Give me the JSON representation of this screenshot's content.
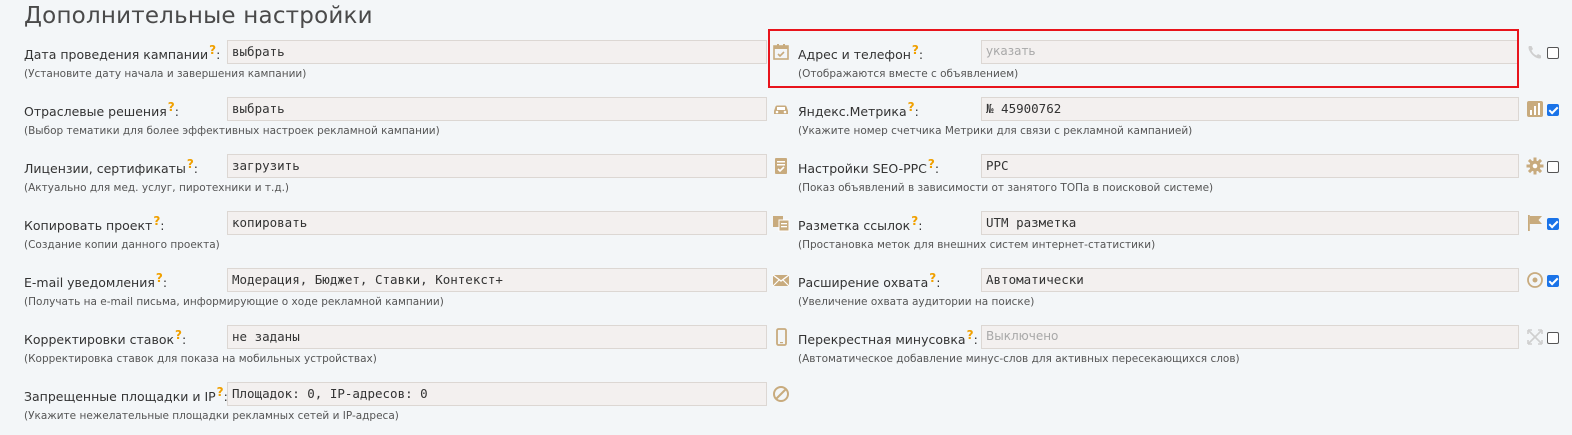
{
  "title": "Дополнительные настройки",
  "question_mark": "?",
  "colon": ":",
  "left": [
    {
      "label": "Дата проведения кампании",
      "hint": "(Установите дату начала и завершения кампании)",
      "value": "выбрать"
    },
    {
      "label": "Отраслевые решения",
      "hint": "(Выбор тематики для более эффективных настроек рекламной кампании)",
      "value": "выбрать"
    },
    {
      "label": "Лицензии, сертификаты",
      "hint": "(Актуально для мед. услуг, пиротехники и т.д.)",
      "value": "загрузить"
    },
    {
      "label": "Копировать проект",
      "hint": "(Создание копии данного проекта)",
      "value": "копировать"
    },
    {
      "label": "E-mail уведомления",
      "hint": "(Получать на e-mail письма, информирующие о ходе рекламной кампании)",
      "value": "Модерация, Бюджет, Ставки, Контекст+"
    },
    {
      "label": "Корректировки ставок",
      "hint": "(Корректировка ставок для показа на мобильных устройствах)",
      "value": "не заданы"
    },
    {
      "label": "Запрещенные площадки и IP",
      "hint": "(Укажите нежелательные площадки рекламных сетей и IP-адреса)",
      "value": "Площадок: 0, IP-адресов: 0"
    }
  ],
  "right": [
    {
      "label": "Адрес и телефон",
      "hint": "(Отображаются вместе с объявлением)",
      "value": "указать",
      "checked": false
    },
    {
      "label": "Яндекс.Метрика",
      "hint": "(Укажите номер счетчика Метрики для связи с рекламной кампанией)",
      "value": "№ 45900762",
      "checked": true
    },
    {
      "label": "Настройки SEO-PPC",
      "hint": "(Показ объявлений в зависимости от занятого ТОПа в поисковой системе)",
      "value": "PPC",
      "checked": false
    },
    {
      "label": "Разметка ссылок",
      "hint": "(Простановка меток для внешних систем интернет-статистики)",
      "value": "UTM разметка",
      "checked": true
    },
    {
      "label": "Расширение охвата",
      "hint": "(Увеличение охвата аудитории на поиске)",
      "value": "Автоматически",
      "checked": true
    },
    {
      "label": "Перекрестная минусовка",
      "hint": "(Автоматическое добавление минус-слов для активных пересекающихся слов)",
      "value": "Выключено",
      "checked": false
    }
  ],
  "icons": {
    "left": [
      "calendar-icon",
      "car-icon",
      "document-icon",
      "copy-icon",
      "mail-icon",
      "mobile-icon",
      "block-icon"
    ],
    "right": [
      "phone-icon",
      "chart-icon",
      "gear-icon",
      "flag-icon",
      "target-icon",
      "cross-arrows-icon"
    ]
  },
  "colors": {
    "icon": "#c8ab7e",
    "icon_muted": "#cfcfcf",
    "question": "#f0a000",
    "highlight": "#e8141c",
    "checkbox": "#1a73e8"
  }
}
